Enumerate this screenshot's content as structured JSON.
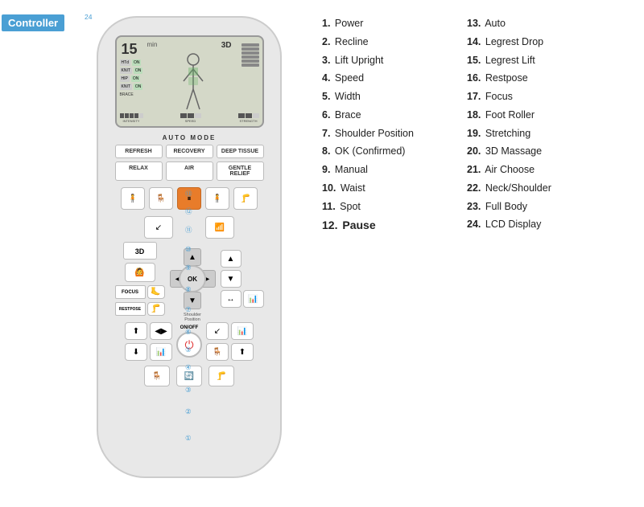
{
  "header": {
    "controller_label": "Controller"
  },
  "remote": {
    "auto_mode_title": "AUTO MODE",
    "lcd_time": "15",
    "lcd_3d": "3D",
    "buttons": {
      "refresh": "REFRESH",
      "recovery": "RECOVERY",
      "deep_tissue": "DEEP TISSUE",
      "relax": "RELAX",
      "air": "AIR",
      "gentle_relief": "GENTLE RELIEF",
      "three_d": "3D",
      "ok": "OK",
      "on_off_title": "ON/OFF"
    }
  },
  "numbered_list": {
    "col1": [
      {
        "num": "1.",
        "label": "Power"
      },
      {
        "num": "2.",
        "label": "Recline"
      },
      {
        "num": "3.",
        "label": "Lift Upright"
      },
      {
        "num": "4.",
        "label": "Speed"
      },
      {
        "num": "5.",
        "label": "Width"
      },
      {
        "num": "6.",
        "label": "Brace"
      },
      {
        "num": "7.",
        "label": "Shoulder Position"
      },
      {
        "num": "8.",
        "label": "OK (Confirmed)"
      },
      {
        "num": "9.",
        "label": "Manual"
      },
      {
        "num": "10.",
        "label": "Waist"
      },
      {
        "num": "11.",
        "label": "Spot"
      },
      {
        "num": "12.",
        "label": "Pause",
        "bold": true
      }
    ],
    "col2": [
      {
        "num": "13.",
        "label": "Auto"
      },
      {
        "num": "14.",
        "label": "Legrest Drop"
      },
      {
        "num": "15.",
        "label": "Legrest Lift"
      },
      {
        "num": "16.",
        "label": "Restpose"
      },
      {
        "num": "17.",
        "label": "Focus"
      },
      {
        "num": "18.",
        "label": "Foot Roller"
      },
      {
        "num": "19.",
        "label": "Stretching"
      },
      {
        "num": "20.",
        "label": "3D Massage"
      },
      {
        "num": "21.",
        "label": "Air Choose"
      },
      {
        "num": "22.",
        "label": "Neck/Shoulder"
      },
      {
        "num": "23.",
        "label": "Full Body"
      },
      {
        "num": "24.",
        "label": "LCD Display"
      }
    ]
  },
  "annotations": {
    "shoulder_pos_label": "Shoulder\nPosition"
  }
}
